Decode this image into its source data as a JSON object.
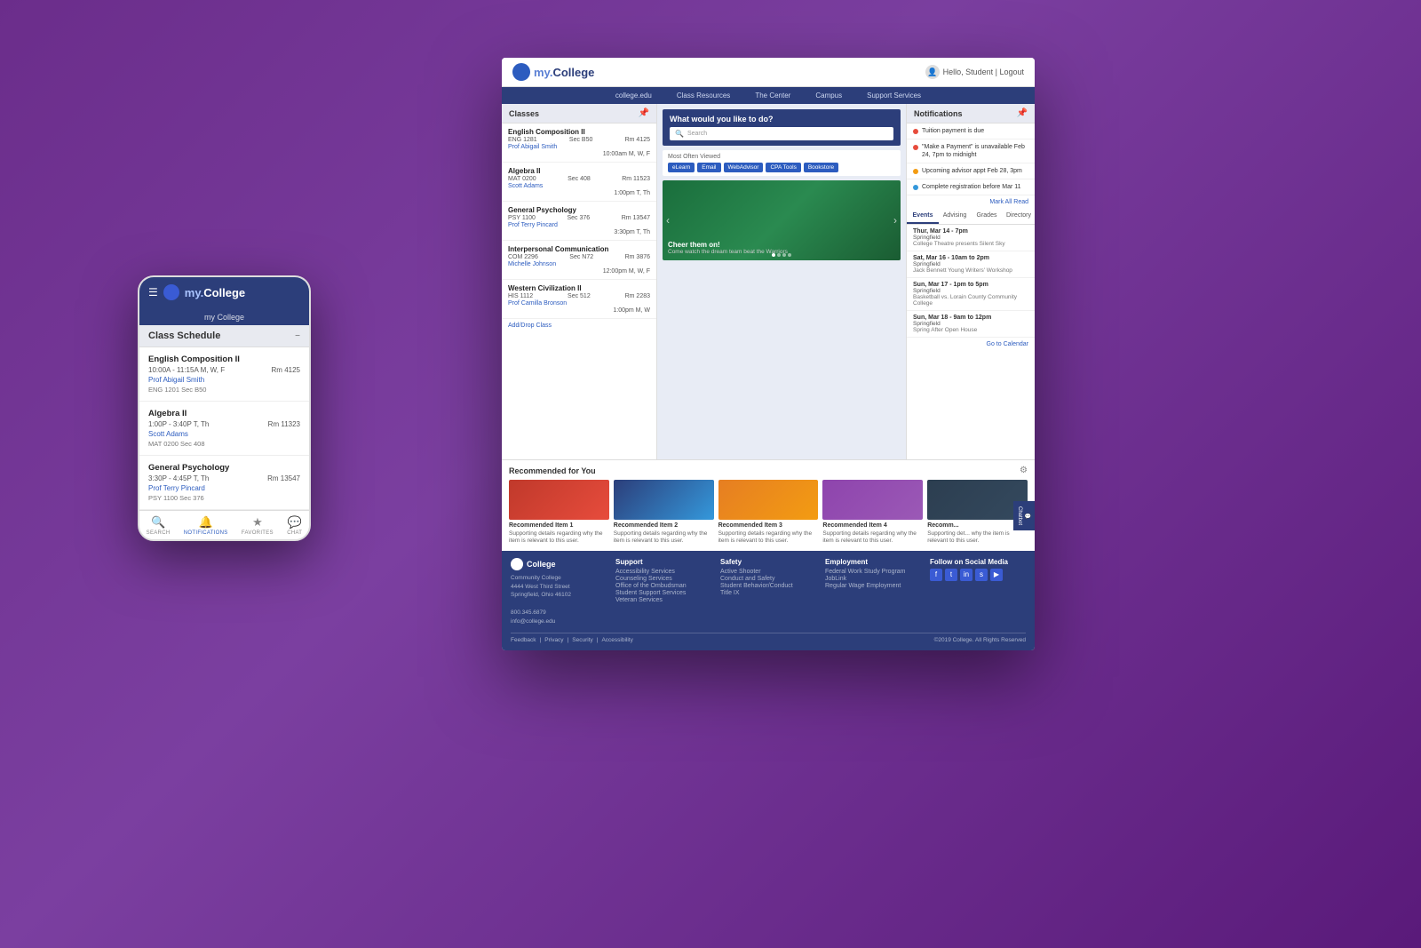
{
  "background": "#7b3fa0",
  "mobile": {
    "logo_text": "my.",
    "logo_brand": "College",
    "college_banner": "my College",
    "schedule": {
      "title": "Class Schedule",
      "minimize": "−",
      "classes": [
        {
          "name": "English Composition II",
          "time": "10:00A - 11:15A M, W, F",
          "room": "Rm 4125",
          "professor": "Prof Abigail Smith",
          "code": "ENG 1201   Sec B50"
        },
        {
          "name": "Algebra II",
          "time": "1:00P - 3:40P T, Th",
          "room": "Rm 11323",
          "professor": "Scott Adams",
          "code": "MAT 0200   Sec 408"
        },
        {
          "name": "General Psychology",
          "time": "3:30P - 4:45P T, Th",
          "room": "Rm 13547",
          "professor": "Prof Terry Pincard",
          "code": "PSY 1100   Sec 376"
        }
      ]
    },
    "nav": {
      "items": [
        {
          "icon": "🔍",
          "label": "SEARCH"
        },
        {
          "icon": "🔔",
          "label": "NOTIFICATIONS"
        },
        {
          "icon": "★",
          "label": "FAVORITES"
        },
        {
          "icon": "💬",
          "label": "CHAT"
        }
      ]
    }
  },
  "desktop": {
    "logo_text": "my.",
    "logo_brand": "College",
    "user_text": "Hello, Student  |  Logout",
    "nav_items": [
      "college.edu",
      "Class Resources",
      "The Center",
      "Campus",
      "Support Services"
    ],
    "classes_panel": {
      "title": "Classes",
      "classes": [
        {
          "name": "English Composition II",
          "code": "ENG 1281",
          "sec": "Sec B50",
          "room": "Rm 4125",
          "professor": "Prof Abigail Smith",
          "time": "10:00am M, W, F"
        },
        {
          "name": "Algebra II",
          "code": "MAT 0200",
          "sec": "Sec 408",
          "room": "Rm 11523",
          "professor": "Scott Adams",
          "time": "1:00pm T, Th"
        },
        {
          "name": "General Psychology",
          "code": "PSY 1100",
          "sec": "Sec 376",
          "room": "Rm 13547",
          "professor": "Prof Terry Pincard",
          "time": "3:30pm T, Th"
        },
        {
          "name": "Interpersonal Communication",
          "code": "COM 2296",
          "sec": "Sec N72",
          "room": "Rm 3876",
          "professor": "Michelle Johnson",
          "time": "12:00pm M, W, F"
        },
        {
          "name": "Western Civilization II",
          "code": "HIS 1112",
          "sec": "Sec 512",
          "room": "Rm 2283",
          "professor": "Prof Camilla Bronson",
          "time": "1:00pm M, W"
        }
      ],
      "add_drop": "Add/Drop Class"
    },
    "what_todo": {
      "title": "What would you like to do?",
      "search_placeholder": "Search",
      "most_viewed": {
        "title": "Most Often Viewed",
        "buttons": [
          "eLearn",
          "Email",
          "WebAdvisor",
          "CPA Tools",
          "Bookstore"
        ]
      }
    },
    "carousel": {
      "text": "Cheer them on!",
      "subtext": "Come watch the dream team beat the Warriors"
    },
    "notifications": {
      "title": "Notifications",
      "items": [
        {
          "color": "red",
          "text": "Tuition payment is due"
        },
        {
          "color": "red",
          "text": "\"Make a Payment\" is unavailable Feb 24, 7pm to midnight"
        },
        {
          "color": "yellow",
          "text": "Upcoming advisor appt Feb 28, 3pm"
        },
        {
          "color": "blue",
          "text": "Complete registration before Mar 11"
        }
      ],
      "mark_all": "Mark All Read"
    },
    "events": {
      "tabs": [
        "Events",
        "Advising",
        "Grades",
        "Directory"
      ],
      "active_tab": "Events",
      "items": [
        {
          "date": "Thur, Mar 14 - 7pm",
          "location": "Springfield",
          "detail": "College Theatre presents Silent Sky"
        },
        {
          "date": "Sat, Mar 16 - 10am to 2pm",
          "location": "Springfield",
          "detail": "Jack Bennett Young Writers' Workshop"
        },
        {
          "date": "Sun, Mar 17 - 1pm to 5pm",
          "location": "Springfield",
          "detail": "Basketball vs. Lorain County Community College"
        },
        {
          "date": "Sun, Mar 18 - 9am to 12pm",
          "location": "Springfield",
          "detail": "Spring After Open House"
        }
      ],
      "go_to_calendar": "Go to Calendar"
    },
    "recommended": {
      "title": "Recommended for You",
      "items": [
        {
          "title": "Recommended Item 1",
          "desc": "Supporting details regarding why the item is relevant to this user."
        },
        {
          "title": "Recommended Item 2",
          "desc": "Supporting details regarding why the item is relevant to this user."
        },
        {
          "title": "Recommended Item 3",
          "desc": "Supporting details regarding why the item is relevant to this user."
        },
        {
          "title": "Recommended Item 4",
          "desc": "Supporting details regarding why the item is relevant to this user."
        },
        {
          "title": "Recomm...",
          "desc": "Supporting det... why the item is relevant to this user."
        }
      ]
    },
    "footer": {
      "logo_text": "College",
      "address": "Community College\n4444 West Third Street\nSpringfield, Ohio 46102\n\n800.345.6879\ninfo@college.edu",
      "columns": [
        {
          "title": "Support",
          "items": [
            "Accessibility Services",
            "Counseling Services",
            "Office of the Ombudsman",
            "Student Support Services",
            "Veteran Services"
          ]
        },
        {
          "title": "Safety",
          "items": [
            "Active Shooter",
            "Conduct and Safety",
            "Student Behavior/Conduct",
            "Title IX"
          ]
        },
        {
          "title": "Employment",
          "items": [
            "Federal Work Study Program",
            "JobLink",
            "Regular Wage Employment"
          ]
        },
        {
          "title": "Follow on Social Media",
          "social_icons": [
            "f",
            "t",
            "in",
            "sc",
            "yt"
          ]
        }
      ],
      "bottom_links": [
        "Feedback",
        "Privacy",
        "Security",
        "Accessibility"
      ],
      "copyright": "©2019 College. All Rights Reserved"
    }
  }
}
